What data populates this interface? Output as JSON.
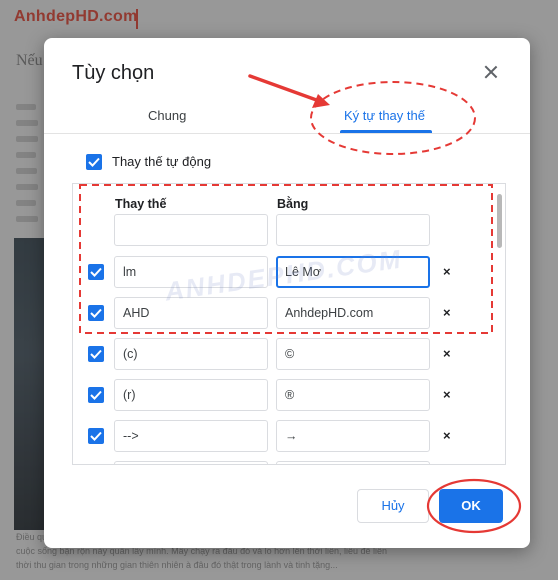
{
  "background": {
    "logo_text": "AnhdepHD.com",
    "heading_fragment": "Nếu",
    "footer_line1": "Điều quan trọng nhất",
    "footer_line2": "cuộc sống bận rộn này quân lấy mình. Mấy chạy ra đâu đó và lo hơn lên thời liền, liều để liền",
    "footer_line3": "thời thu gian trong những gian thiên nhiên à đâu đó thật trong lành và tinh tặng..."
  },
  "dialog": {
    "title": "Tùy chọn",
    "tabs": [
      {
        "label": "Chung",
        "active": false
      },
      {
        "label": "Ký tự thay thế",
        "active": true
      }
    ],
    "auto_substitute": {
      "label": "Thay thế tự động",
      "checked": true
    },
    "table": {
      "headers": {
        "replace": "Thay thế",
        "with": "Bằng"
      },
      "new_row": {
        "replace": "",
        "with": ""
      },
      "rows": [
        {
          "checked": true,
          "replace": "lm",
          "with": "Lê Mơ",
          "focused": true
        },
        {
          "checked": true,
          "replace": "AHD",
          "with": "AnhdepHD.com",
          "focused": false
        },
        {
          "checked": true,
          "replace": "(c)",
          "with": "©",
          "focused": false
        },
        {
          "checked": true,
          "replace": "(r)",
          "with": "®",
          "focused": false
        },
        {
          "checked": true,
          "replace": "-->",
          "with": "→",
          "focused": false
        }
      ],
      "delete_symbol": "×"
    },
    "buttons": {
      "cancel": "Hủy",
      "ok": "OK"
    }
  },
  "watermark": {
    "text": "ANHDEPHD.COM"
  },
  "colors": {
    "accent": "#1a73e8",
    "annotation": "#e53935",
    "logo": "#c0392b"
  },
  "icons": {
    "close": "close-icon",
    "checkmark": "check-icon",
    "delete": "delete-x-icon"
  }
}
